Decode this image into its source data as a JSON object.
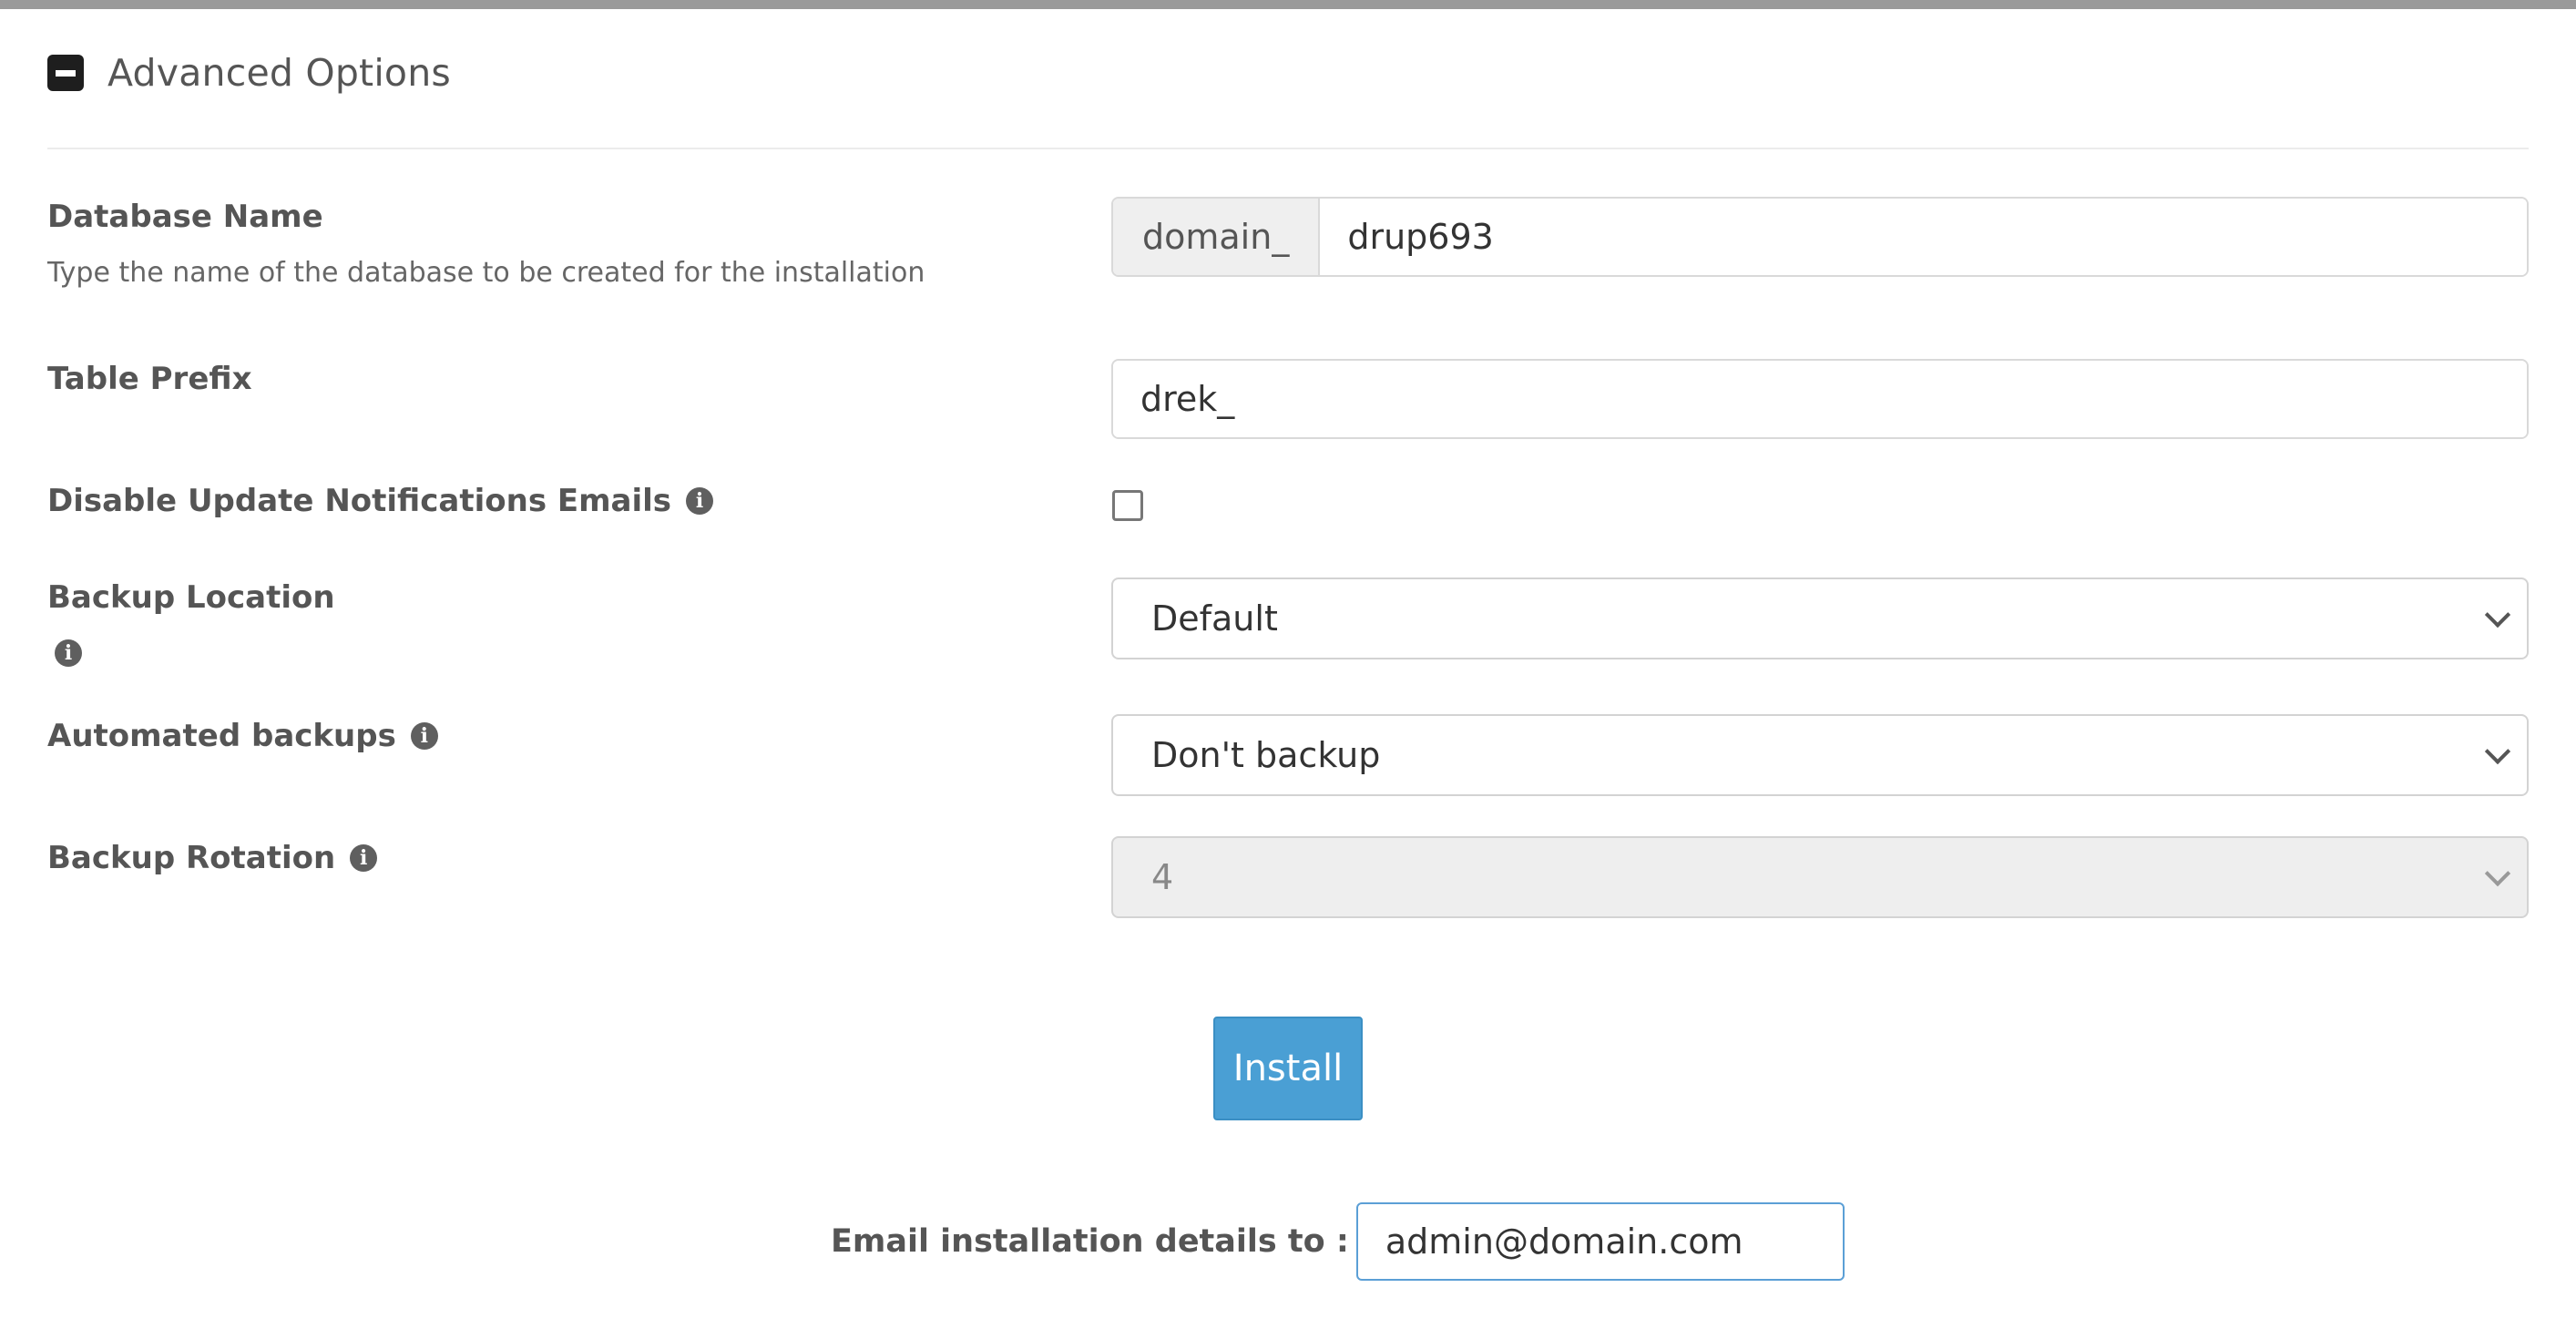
{
  "section": {
    "title": "Advanced Options",
    "icon": "minus-square-icon"
  },
  "database_name": {
    "label": "Database Name",
    "help": "Type the name of the database to be created for the installation",
    "prefix": "domain_",
    "value": "drup693"
  },
  "table_prefix": {
    "label": "Table Prefix",
    "value": "drek_"
  },
  "disable_update_emails": {
    "label": "Disable Update Notifications Emails",
    "checked": false
  },
  "backup_location": {
    "label": "Backup Location",
    "selected": "Default"
  },
  "automated_backups": {
    "label": "Automated backups",
    "selected": "Don't backup"
  },
  "backup_rotation": {
    "label": "Backup Rotation",
    "selected": "4",
    "disabled": true
  },
  "install_button": {
    "label": "Install",
    "color": "#4a9fd4"
  },
  "email": {
    "label": "Email installation details to :",
    "value": "admin@domain.com"
  },
  "info_icon_glyph": "i"
}
